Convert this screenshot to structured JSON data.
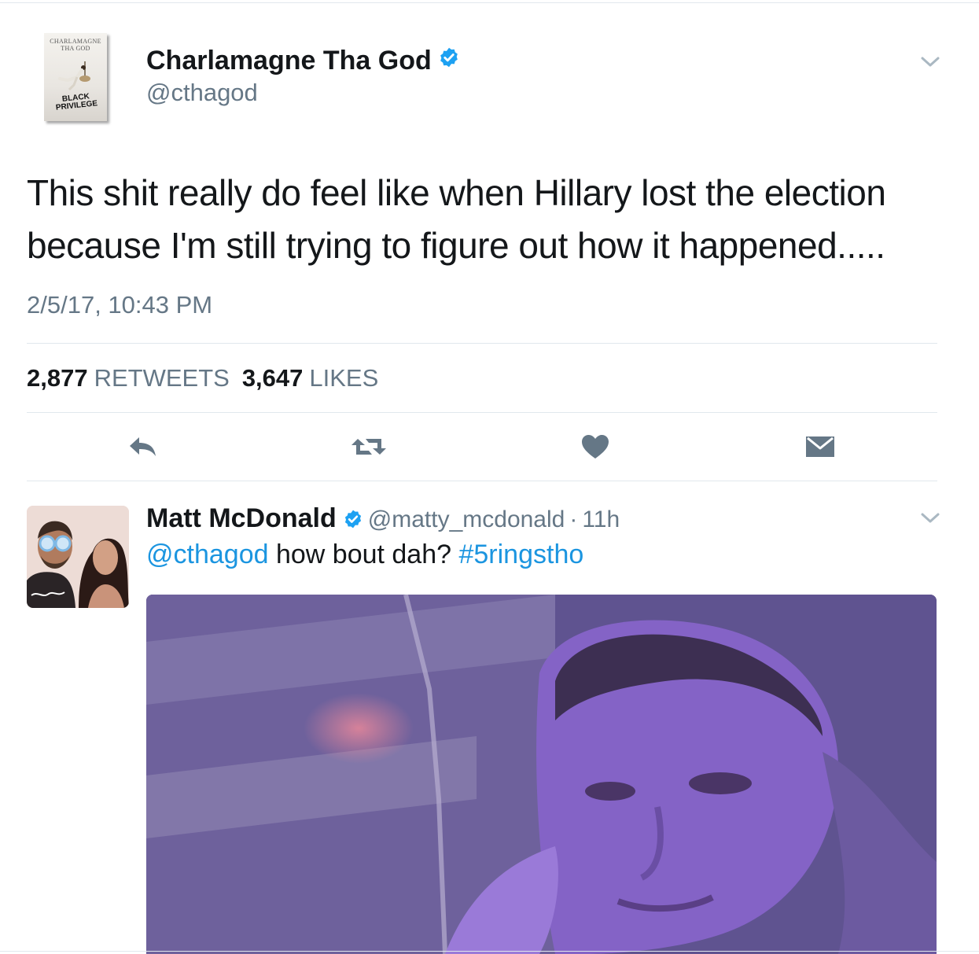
{
  "main_tweet": {
    "author_name": "Charlamagne Tha God",
    "handle": "@cthagod",
    "avatar": {
      "book_title": "CHARLAMAGNE THA GOD",
      "book_subtitle": "BLACK PRIVILEGE"
    },
    "text": "This shit really do feel like when Hillary lost the election because I'm still trying to figure out how it happened.....",
    "timestamp": "2/5/17, 10:43 PM",
    "retweets_count": "2,877",
    "retweets_label": "RETWEETS",
    "likes_count": "3,647",
    "likes_label": "LIKES"
  },
  "actions": [
    "reply-icon",
    "retweet-icon",
    "heart-icon",
    "direct-message-icon"
  ],
  "reply": {
    "author_name": "Matt McDonald",
    "handle": "@matty_mcdonald",
    "separator": "·",
    "time": "11h",
    "mention": "@cthagod",
    "text": " how bout dah? ",
    "hashtag": "#5ringstho"
  },
  "colors": {
    "text_primary": "#14171a",
    "text_secondary": "#657786",
    "link": "#1b95e0",
    "verified": "#1da1f2",
    "icon": "#657786",
    "divider": "#e1e8ed"
  }
}
